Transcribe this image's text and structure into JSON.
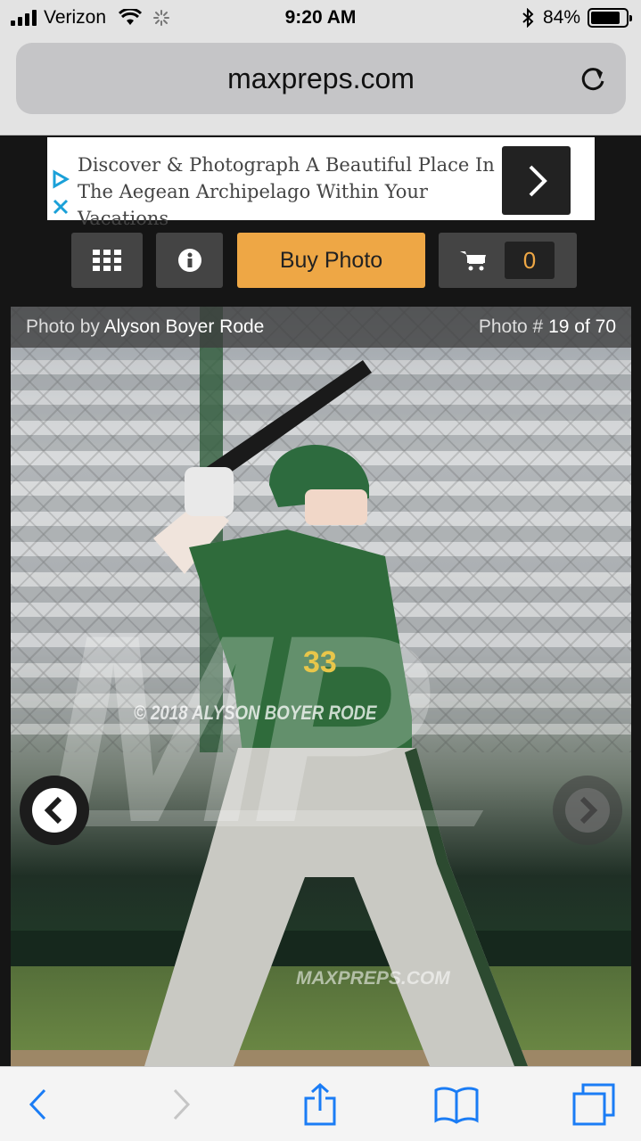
{
  "status_bar": {
    "carrier": "Verizon",
    "time": "9:20 AM",
    "battery": "84%",
    "battery_level": 0.84
  },
  "browser": {
    "url": "maxpreps.com"
  },
  "ad": {
    "text": "Discover & Photograph A Beautiful Place In The Aegean Archipelago Within Your Vacations"
  },
  "toolbar": {
    "buy_label": "Buy Photo",
    "cart_count": "0",
    "accent_color": "#eea745"
  },
  "photo": {
    "credit_prefix": "Photo by",
    "photographer": "Alyson Boyer Rode",
    "number_prefix": "Photo #",
    "number_text": "19 of 70",
    "watermark_copyright": "© 2018 ALYSON BOYER RODE",
    "watermark_logo": "MP",
    "watermark_site": "MAXPREPS.COM",
    "jersey_number": "33"
  }
}
